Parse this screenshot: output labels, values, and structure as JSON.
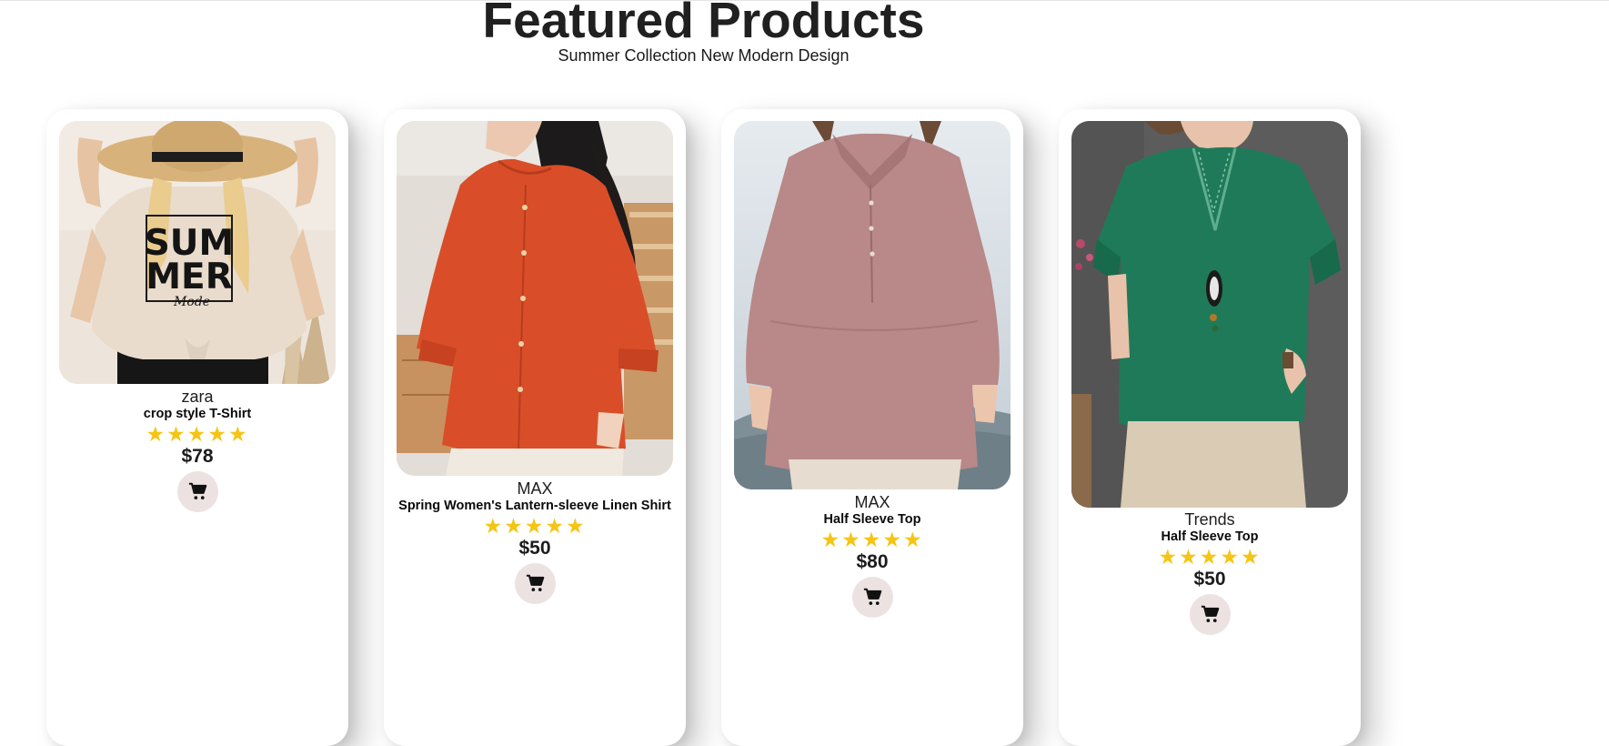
{
  "section": {
    "title": "Featured Products",
    "subtitle": "Summer Collection New Modern Design"
  },
  "products": [
    {
      "brand": "zara",
      "name": "crop style T-Shirt",
      "rating": 5,
      "price": "$78",
      "image": {
        "text_line1": "SUM",
        "text_line2": "MER",
        "script": "Mode"
      }
    },
    {
      "brand": "MAX",
      "name": "Spring Women's Lantern-sleeve Linen Shirt",
      "rating": 5,
      "price": "$50"
    },
    {
      "brand": "MAX",
      "name": "Half Sleeve Top",
      "rating": 5,
      "price": "$80"
    },
    {
      "brand": "Trends",
      "name": "Half Sleeve Top",
      "rating": 5,
      "price": "$50"
    }
  ],
  "colors": {
    "star": "#f5c515",
    "cart_bg": "#ede2e2",
    "background": "#ffffff"
  },
  "icons": {
    "cart": "shopping-cart-icon",
    "star": "star-icon"
  }
}
